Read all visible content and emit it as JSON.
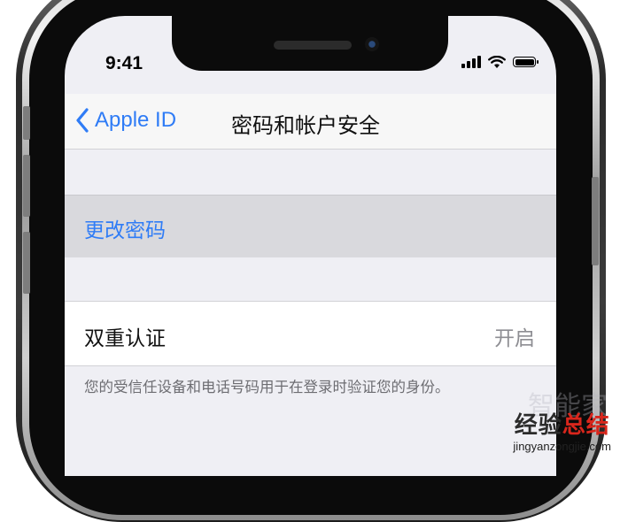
{
  "status_bar": {
    "time": "9:41"
  },
  "nav": {
    "back_label": "Apple ID",
    "title": "密码和帐户安全"
  },
  "rows": {
    "change_password": {
      "label": "更改密码"
    },
    "two_factor": {
      "label": "双重认证",
      "value": "开启"
    }
  },
  "footnote": "您的受信任设备和电话号码用于在登录时验证您的身份。",
  "watermark": {
    "brand": "经验总结",
    "brand_plain": "经验",
    "brand_accent": "总结",
    "url": "jingyanzongjie.com",
    "faint": "智能家"
  },
  "colors": {
    "accent": "#2f7cf6",
    "background": "#efeff4"
  },
  "icons": [
    "back-chevron-icon",
    "signal-icon",
    "wifi-icon",
    "battery-icon"
  ]
}
